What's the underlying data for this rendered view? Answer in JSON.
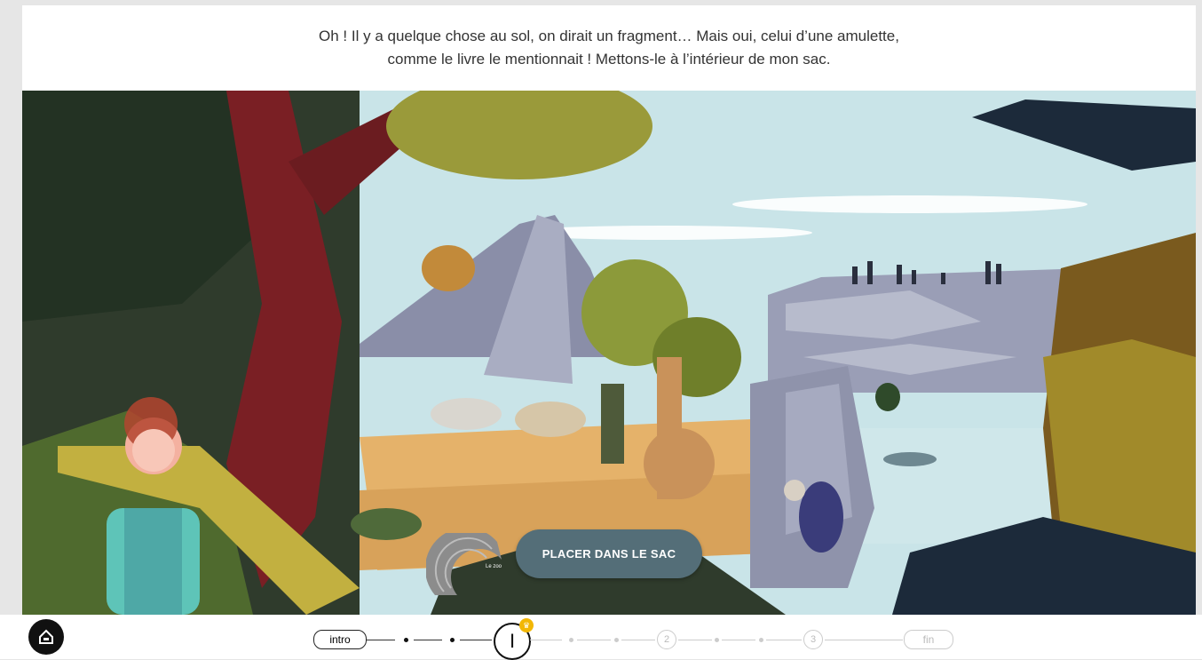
{
  "dialogue": {
    "line1": "Oh ! Il y a quelque chose au sol, on dirait un fragment… Mais oui, celui d’une amulette,",
    "line2": "comme le livre le mentionnait ! Mettons-le à l’intérieur de mon sac."
  },
  "scene": {
    "amulet_label": "Le zoo",
    "cta_label": "PLACER DANS LE SAC"
  },
  "nav": {
    "home_icon": "home-icon",
    "progress": {
      "intro_label": "intro",
      "current_label": "I",
      "step2_label": "2",
      "step3_label": "3",
      "end_label": "fin",
      "badge_icon": "crown-icon"
    }
  },
  "colors": {
    "cta": "#546e78",
    "badge": "#f2b705",
    "sky": "#c9e4e8"
  }
}
